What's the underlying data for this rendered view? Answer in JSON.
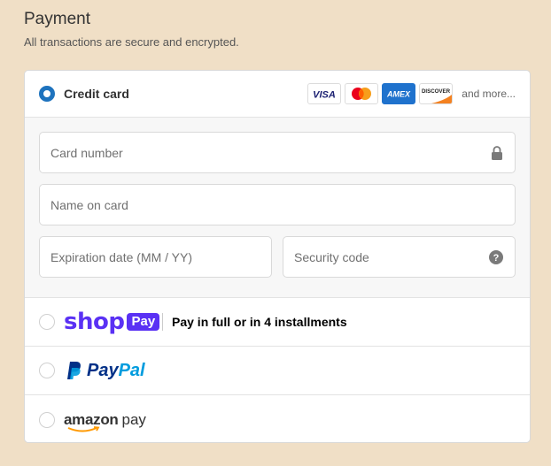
{
  "header": {
    "title": "Payment",
    "subtitle": "All transactions are secure and encrypted."
  },
  "credit_card": {
    "label": "Credit card",
    "selected": true,
    "card_brands": [
      "VISA",
      "Mastercard",
      "AMEX",
      "DISCOVER"
    ],
    "more_text": "and more..."
  },
  "form": {
    "card_number_placeholder": "Card number",
    "name_placeholder": "Name on card",
    "expiration_placeholder": "Expiration date (MM / YY)",
    "security_placeholder": "Security code"
  },
  "methods": {
    "shop_pay": {
      "logo_shop": "shop",
      "logo_pay": "Pay",
      "tagline": "Pay in full or in 4 installments"
    },
    "paypal": {
      "logo_text_pay": "Pay",
      "logo_text_pal": "Pal"
    },
    "amazon_pay": {
      "logo_text_amazon": "amazon",
      "logo_text_pay": "pay"
    }
  },
  "colors": {
    "background": "#f0dfc6",
    "accent": "#1e73be",
    "shop_purple": "#5a31f4",
    "paypal_dark": "#003087",
    "paypal_light": "#009cde"
  }
}
